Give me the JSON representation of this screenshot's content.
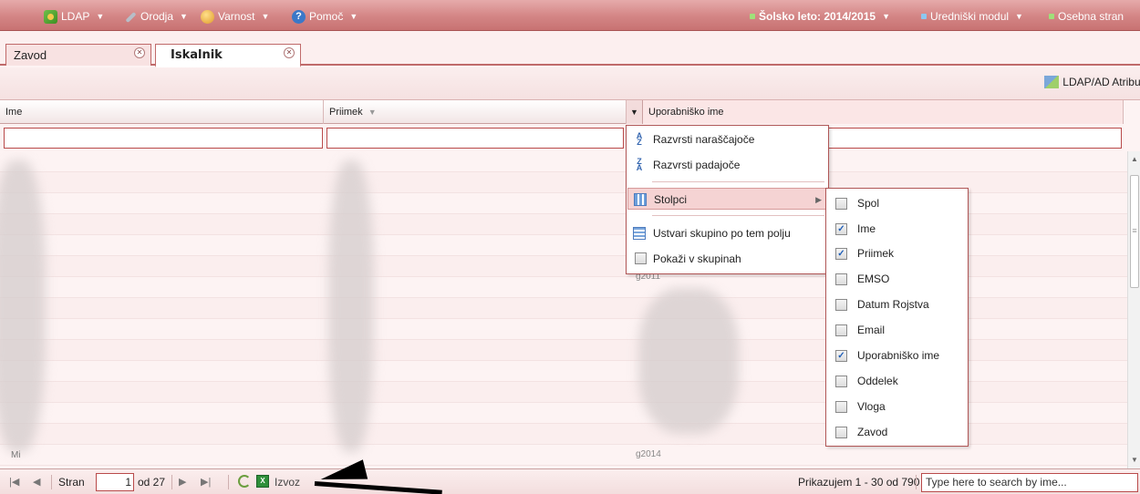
{
  "menu": {
    "items": [
      {
        "label": "LDAP",
        "icon": "ldap-icon"
      },
      {
        "label": "Orodja",
        "icon": "tools-icon"
      },
      {
        "label": "Varnost",
        "icon": "security-icon"
      },
      {
        "label": "Pomoč",
        "icon": "help-icon"
      }
    ],
    "school_year": "Šolsko leto: 2014/2015",
    "editor_module": "Uredniški modul",
    "personal_page": "Osebna stran"
  },
  "tabs": [
    {
      "label": "Zavod",
      "active": false
    },
    {
      "label": "Iskalnik",
      "active": true
    }
  ],
  "toolbar": {
    "ldap_attr_label": "LDAP/AD Atribut"
  },
  "grid": {
    "columns": [
      "Ime",
      "Priimek",
      "Uporabniško ime"
    ],
    "row_text_name": "Mi",
    "row_text_username": "g2014",
    "row_text_username2": "g2011"
  },
  "context_menu": {
    "sort_asc": "Razvrsti naraščajoče",
    "sort_desc": "Razvrsti padajoče",
    "columns": "Stolpci",
    "group_by": "Ustvari skupino po tem polju",
    "show_in_groups": "Pokaži v skupinah"
  },
  "columns_menu": [
    {
      "label": "Spol",
      "checked": false
    },
    {
      "label": "Ime",
      "checked": true
    },
    {
      "label": "Priimek",
      "checked": true
    },
    {
      "label": "EMSO",
      "checked": false
    },
    {
      "label": "Datum Rojstva",
      "checked": false
    },
    {
      "label": "Email",
      "checked": false
    },
    {
      "label": "Uporabniško ime",
      "checked": true
    },
    {
      "label": "Oddelek",
      "checked": false
    },
    {
      "label": "Vloga",
      "checked": false
    },
    {
      "label": "Zavod",
      "checked": false
    }
  ],
  "paging": {
    "page_label": "Stran",
    "page_value": "1",
    "of_label": "od 27",
    "export_label": "Izvoz",
    "status": "Prikazujem 1 - 30 od 790",
    "search_value": "Type here to search by ime..."
  },
  "colors": {
    "accent": "#c87272",
    "border": "#b94a4a",
    "background": "#fdf3f3"
  }
}
